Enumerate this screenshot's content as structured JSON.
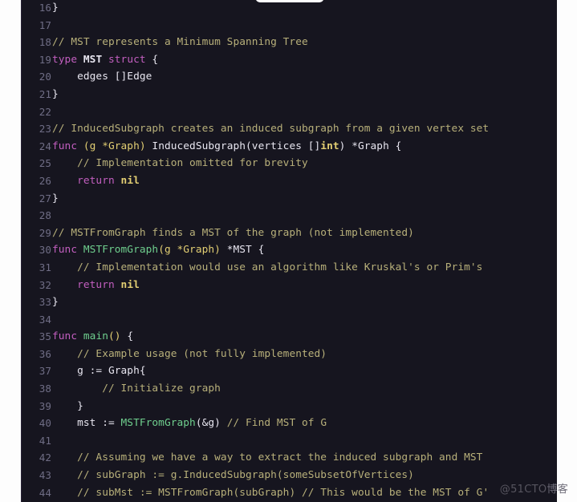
{
  "editor": {
    "language": "Go",
    "theme_background": "#16151f",
    "gutter_color": "#6f6d85",
    "first_line_number": 16,
    "last_line_number": 44,
    "line_height_px": 21.6,
    "colors": {
      "comment": "#b8b07a",
      "keyword": "#c35fc0",
      "function": "#6fcf8e",
      "punctuation": "#e3cf73",
      "value": "#e3cf73",
      "text": "#e8e6f0",
      "page": "#fdfdfd"
    }
  },
  "watermark": {
    "text": "@51CTO",
    "text_cn": "博客"
  },
  "lines": [
    {
      "n": "16",
      "tokens": [
        {
          "t": "}",
          "c": "t-plain"
        }
      ]
    },
    {
      "n": "17",
      "tokens": []
    },
    {
      "n": "18",
      "tokens": [
        {
          "t": "// MST represents a Minimum Spanning Tree",
          "c": "t-comment"
        }
      ]
    },
    {
      "n": "19",
      "tokens": [
        {
          "t": "type",
          "c": "t-kw"
        },
        {
          "t": " ",
          "c": "t-plain"
        },
        {
          "t": "MST",
          "c": "t-type"
        },
        {
          "t": " ",
          "c": "t-plain"
        },
        {
          "t": "struct",
          "c": "t-kw"
        },
        {
          "t": " {",
          "c": "t-plain"
        }
      ]
    },
    {
      "n": "20",
      "tokens": [
        {
          "t": "    edges []Edge",
          "c": "t-plain"
        }
      ]
    },
    {
      "n": "21",
      "tokens": [
        {
          "t": "}",
          "c": "t-plain"
        }
      ]
    },
    {
      "n": "22",
      "tokens": []
    },
    {
      "n": "23",
      "tokens": [
        {
          "t": "// InducedSubgraph creates an induced subgraph from a given vertex set",
          "c": "t-comment"
        }
      ]
    },
    {
      "n": "24",
      "tokens": [
        {
          "t": "func",
          "c": "t-kw"
        },
        {
          "t": " ",
          "c": "t-plain"
        },
        {
          "t": "(g *Graph)",
          "c": "t-punct"
        },
        {
          "t": " InducedSubgraph(vertices []",
          "c": "t-plain"
        },
        {
          "t": "int",
          "c": "t-val"
        },
        {
          "t": ") *Graph {",
          "c": "t-plain"
        }
      ]
    },
    {
      "n": "25",
      "tokens": [
        {
          "t": "    ",
          "c": "t-plain"
        },
        {
          "t": "// Implementation omitted for brevity",
          "c": "t-comment"
        }
      ]
    },
    {
      "n": "26",
      "tokens": [
        {
          "t": "    ",
          "c": "t-plain"
        },
        {
          "t": "return",
          "c": "t-kw"
        },
        {
          "t": " ",
          "c": "t-plain"
        },
        {
          "t": "nil",
          "c": "t-val"
        }
      ]
    },
    {
      "n": "27",
      "tokens": [
        {
          "t": "}",
          "c": "t-plain"
        }
      ]
    },
    {
      "n": "28",
      "tokens": []
    },
    {
      "n": "29",
      "tokens": [
        {
          "t": "// MSTFromGraph finds a MST of the graph (not implemented)",
          "c": "t-comment"
        }
      ]
    },
    {
      "n": "30",
      "tokens": [
        {
          "t": "func",
          "c": "t-kw"
        },
        {
          "t": " ",
          "c": "t-plain"
        },
        {
          "t": "MSTFromGraph",
          "c": "t-fn"
        },
        {
          "t": "(g *Graph)",
          "c": "t-punct"
        },
        {
          "t": " *MST {",
          "c": "t-plain"
        }
      ]
    },
    {
      "n": "31",
      "tokens": [
        {
          "t": "    ",
          "c": "t-plain"
        },
        {
          "t": "// Implementation would use an algorithm like Kruskal's or Prim's",
          "c": "t-comment"
        }
      ]
    },
    {
      "n": "32",
      "tokens": [
        {
          "t": "    ",
          "c": "t-plain"
        },
        {
          "t": "return",
          "c": "t-kw"
        },
        {
          "t": " ",
          "c": "t-plain"
        },
        {
          "t": "nil",
          "c": "t-val"
        }
      ]
    },
    {
      "n": "33",
      "tokens": [
        {
          "t": "}",
          "c": "t-plain"
        }
      ]
    },
    {
      "n": "34",
      "tokens": []
    },
    {
      "n": "35",
      "tokens": [
        {
          "t": "func",
          "c": "t-kw"
        },
        {
          "t": " ",
          "c": "t-plain"
        },
        {
          "t": "main",
          "c": "t-fn"
        },
        {
          "t": "()",
          "c": "t-punct"
        },
        {
          "t": " {",
          "c": "t-plain"
        }
      ]
    },
    {
      "n": "36",
      "tokens": [
        {
          "t": "    ",
          "c": "t-plain"
        },
        {
          "t": "// Example usage (not fully implemented)",
          "c": "t-comment"
        }
      ]
    },
    {
      "n": "37",
      "tokens": [
        {
          "t": "    g := Graph{",
          "c": "t-plain"
        }
      ]
    },
    {
      "n": "38",
      "tokens": [
        {
          "t": "        ",
          "c": "t-plain"
        },
        {
          "t": "// Initialize graph",
          "c": "t-comment"
        }
      ]
    },
    {
      "n": "39",
      "tokens": [
        {
          "t": "    }",
          "c": "t-plain"
        }
      ]
    },
    {
      "n": "40",
      "tokens": [
        {
          "t": "    mst := ",
          "c": "t-plain"
        },
        {
          "t": "MSTFromGraph",
          "c": "t-fn"
        },
        {
          "t": "(&g) ",
          "c": "t-plain"
        },
        {
          "t": "// Find MST of G",
          "c": "t-comment"
        }
      ]
    },
    {
      "n": "41",
      "tokens": []
    },
    {
      "n": "42",
      "tokens": [
        {
          "t": "    ",
          "c": "t-plain"
        },
        {
          "t": "// Assuming we have a way to extract the induced subgraph and MST",
          "c": "t-comment"
        }
      ]
    },
    {
      "n": "43",
      "tokens": [
        {
          "t": "    ",
          "c": "t-plain"
        },
        {
          "t": "// subGraph := g.InducedSubgraph(someSubsetOfVertices)",
          "c": "t-comment"
        }
      ]
    },
    {
      "n": "44",
      "tokens": [
        {
          "t": "    ",
          "c": "t-plain"
        },
        {
          "t": "// subMst := MSTFromGraph(subGraph) // This would be the MST of G'",
          "c": "t-comment"
        }
      ]
    }
  ]
}
